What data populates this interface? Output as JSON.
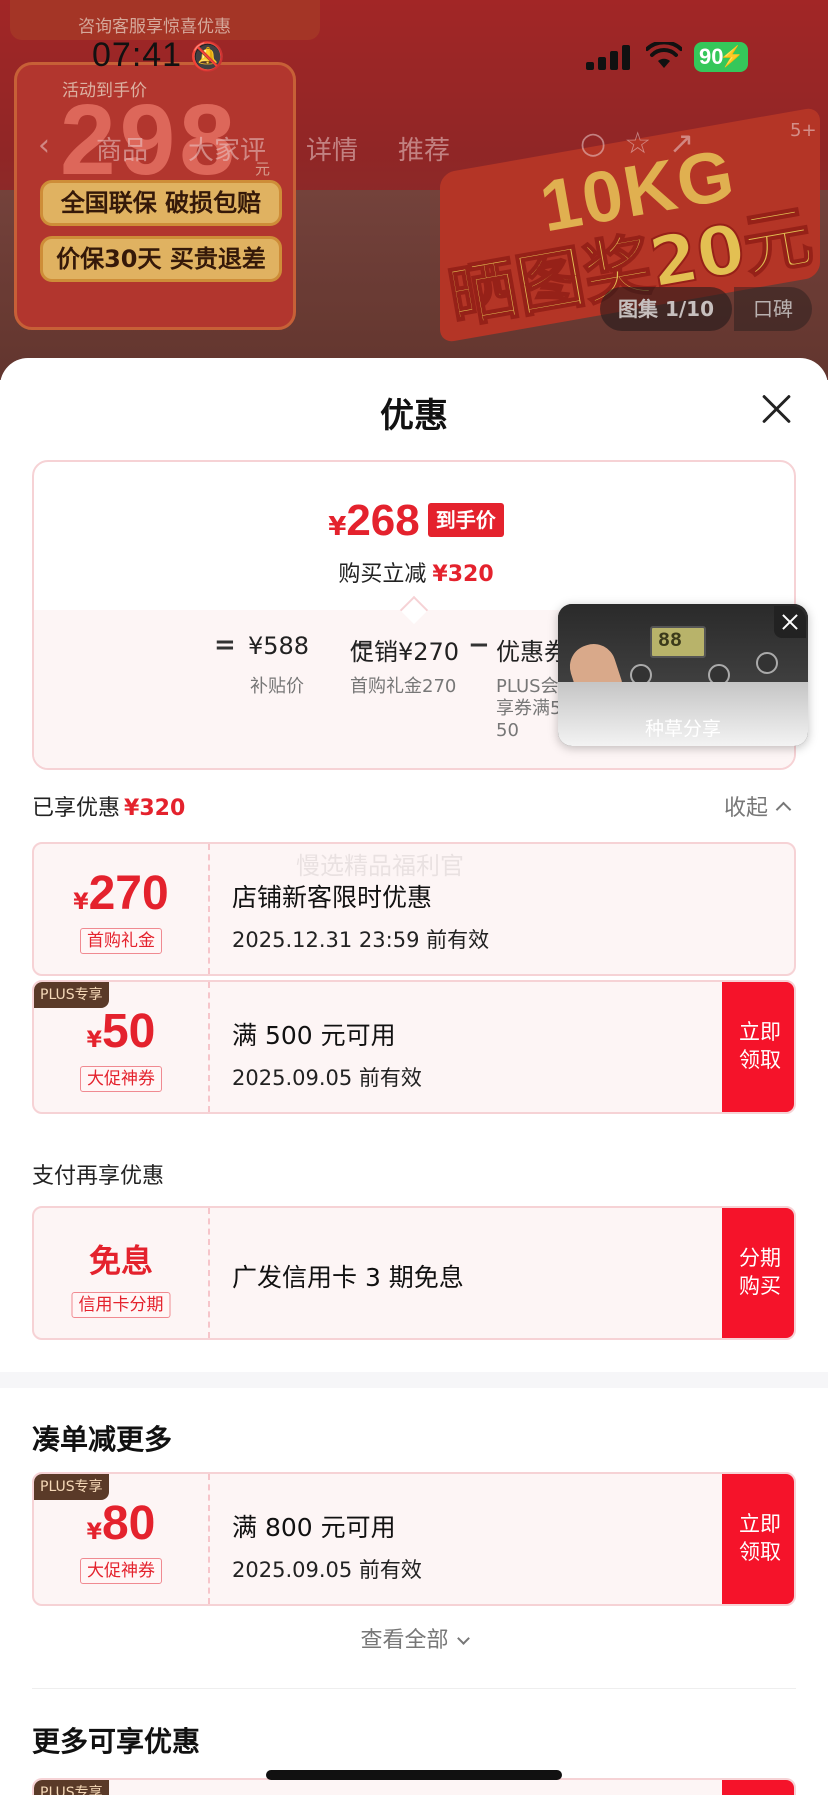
{
  "status_bar": {
    "time": "07:41",
    "battery": "90"
  },
  "background": {
    "promo_top": "咨询客服享惊喜优惠",
    "activity_label": "活动到手价",
    "activity_price": "298",
    "activity_unit": "元",
    "pills": [
      "全国联保 破损包赔",
      "价保30天 买贵退差"
    ],
    "tabs": [
      "商品",
      "大家评",
      "详情",
      "推荐"
    ],
    "ad_line1": "10KG",
    "ad_line2": "晒图奖20元",
    "gallery": "图集 1/10",
    "review": "口碑",
    "badge": "5+"
  },
  "sheet": {
    "title": "优惠",
    "final_price": {
      "currency": "¥",
      "value": "268",
      "tag": "到手价"
    },
    "reduce": {
      "label": "购买立减",
      "value": "¥320"
    },
    "calc": {
      "equals": "=",
      "base": "¥588",
      "base_label": "补贴价",
      "minus1": "−",
      "promo": "促销¥270",
      "promo_label": "首购礼金270",
      "minus2": "−",
      "coupon": "优惠券",
      "coupon_label_1": "PLUS会",
      "coupon_label_2": "享券满5",
      "coupon_label_3": "50"
    },
    "video_caption": "种草分享",
    "video_lcd": "88",
    "enjoyed": {
      "label": "已享优惠",
      "value": "¥320"
    },
    "collapse": "收起",
    "watermark": "慢选精品福利官",
    "coupons": [
      {
        "currency": "¥",
        "amount": "270",
        "tag": "首购礼金",
        "title": "店铺新客限时优惠",
        "valid": "2025.12.31 23:59 前有效"
      },
      {
        "plus": "PLUS专享",
        "currency": "¥",
        "amount": "50",
        "tag": "大促神券",
        "title": "满 500 元可用",
        "valid": "2025.09.05 前有效",
        "btn_1": "立即",
        "btn_2": "领取"
      }
    ],
    "pay_section": "支付再享优惠",
    "pay_coupon": {
      "amount": "免息",
      "tag": "信用卡分期",
      "title": "广发信用卡 3 期免息",
      "btn_1": "分期",
      "btn_2": "购买"
    },
    "more_head": "凑单减更多",
    "more_coupon": {
      "plus": "PLUS专享",
      "currency": "¥",
      "amount": "80",
      "tag": "大促神券",
      "title": "满 800 元可用",
      "valid": "2025.09.05 前有效",
      "btn_1": "立即",
      "btn_2": "领取"
    },
    "view_all": "查看全部",
    "extra_head": "更多可享优惠",
    "extra_plus": "PLUS专享"
  },
  "colors": {
    "accent": "#e4222d",
    "button": "#f5132a",
    "coupon_bg": "#fdf5f5",
    "coupon_border": "#f6d2d5"
  }
}
